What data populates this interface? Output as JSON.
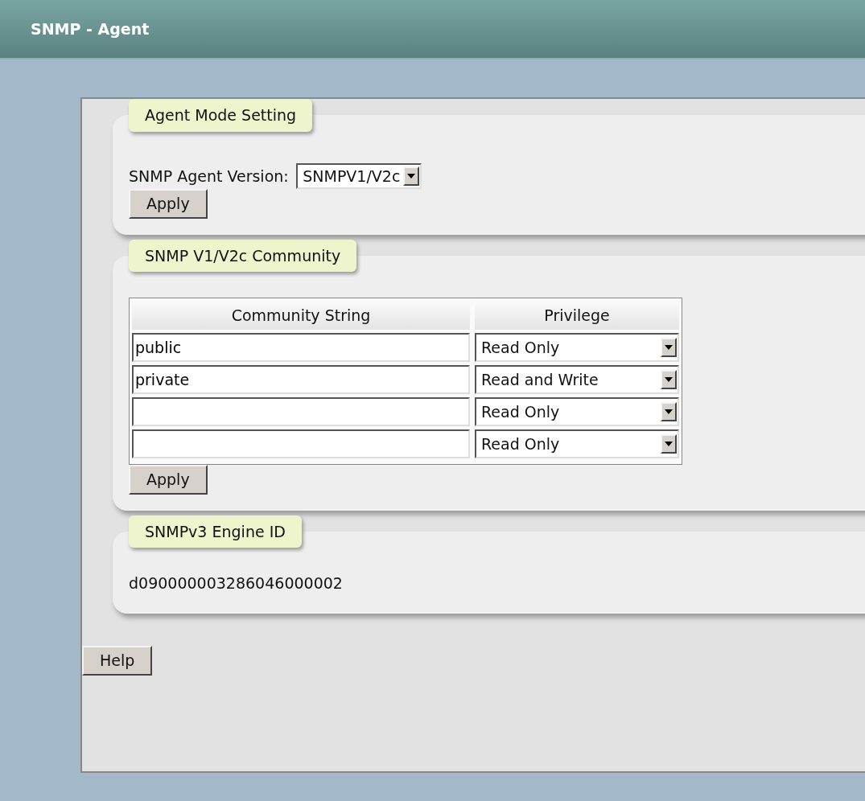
{
  "header": {
    "title": "SNMP - Agent"
  },
  "agent_mode": {
    "legend": "Agent Mode Setting",
    "label": "SNMP Agent Version:",
    "version": "SNMPV1/V2c",
    "apply": "Apply"
  },
  "community": {
    "legend": "SNMP V1/V2c Community",
    "columns": [
      "Community String",
      "Privilege"
    ],
    "rows": [
      {
        "community": "public",
        "privilege": "Read Only"
      },
      {
        "community": "private",
        "privilege": "Read and Write"
      },
      {
        "privilege": "Read Only"
      },
      {
        "privilege": "Read Only"
      }
    ],
    "apply": "Apply"
  },
  "engine": {
    "legend": "SNMPv3 Engine ID",
    "value": "d090000003286046000002"
  },
  "help": "Help"
}
